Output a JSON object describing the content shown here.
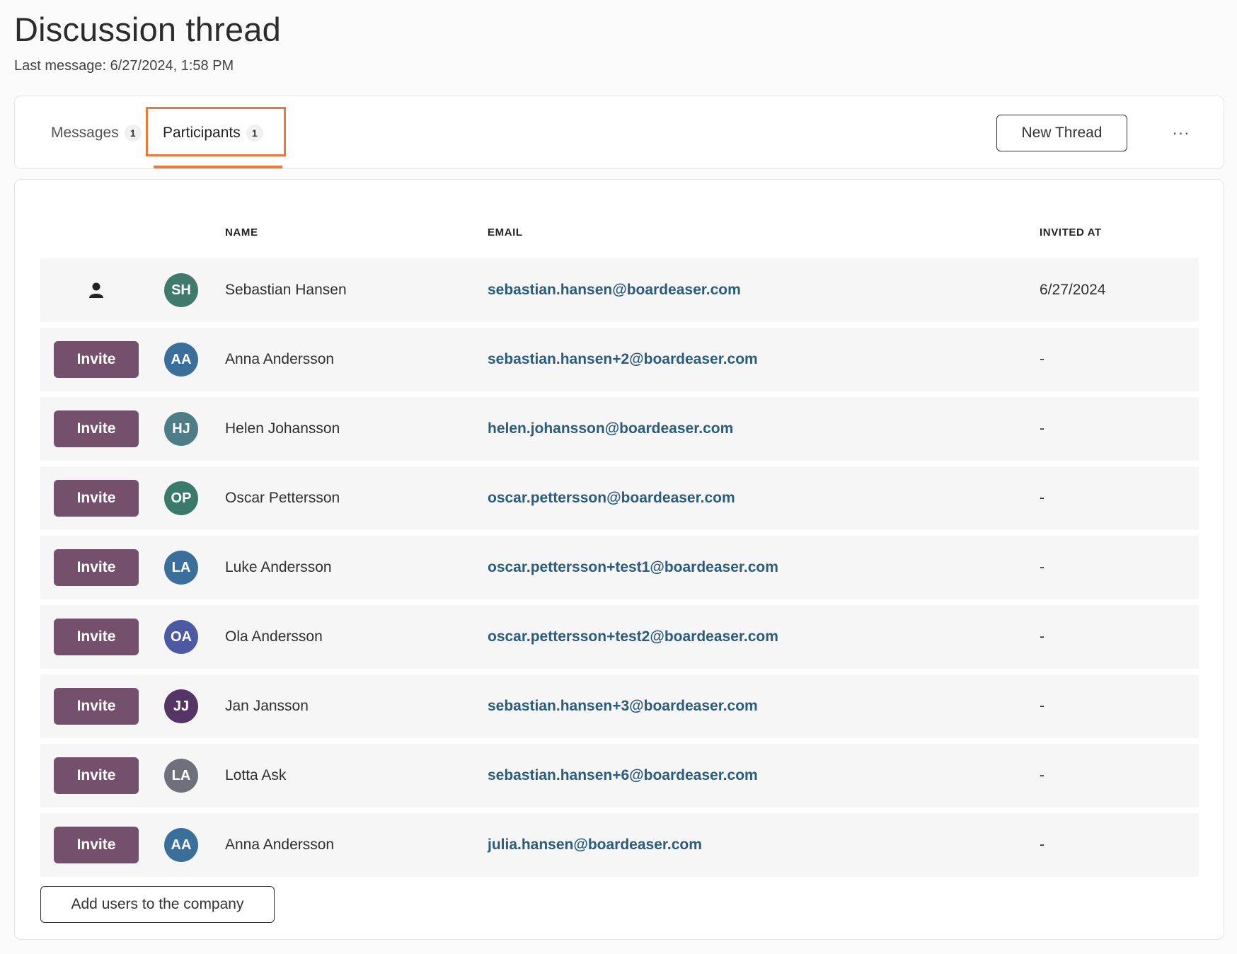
{
  "header": {
    "title": "Discussion thread",
    "last_message": "Last message: 6/27/2024, 1:58 PM"
  },
  "tabs": [
    {
      "label": "Messages",
      "badge": "1"
    },
    {
      "label": "Participants",
      "badge": "1",
      "active": true
    }
  ],
  "toolbar": {
    "new_thread_label": "New Thread",
    "more_label": "···"
  },
  "table": {
    "columns": {
      "name": "NAME",
      "email": "EMAIL",
      "invited_at": "INVITED AT"
    },
    "invite_label": "Invite",
    "rows": [
      {
        "initials": "SH",
        "name": "Sebastian Hansen",
        "email": "sebastian.hansen@boardeaser.com",
        "invited_at": "6/27/2024",
        "avatar_color": "#3f7a6c",
        "action": "user-icon"
      },
      {
        "initials": "AA",
        "name": "Anna Andersson",
        "email": "sebastian.hansen+2@boardeaser.com",
        "invited_at": "-",
        "avatar_color": "#3a6f9c",
        "action": "invite"
      },
      {
        "initials": "HJ",
        "name": "Helen Johansson",
        "email": "helen.johansson@boardeaser.com",
        "invited_at": "-",
        "avatar_color": "#4d7e87",
        "action": "invite"
      },
      {
        "initials": "OP",
        "name": "Oscar Pettersson",
        "email": "oscar.pettersson@boardeaser.com",
        "invited_at": "-",
        "avatar_color": "#3a7a6a",
        "action": "invite"
      },
      {
        "initials": "LA",
        "name": "Luke Andersson",
        "email": "oscar.pettersson+test1@boardeaser.com",
        "invited_at": "-",
        "avatar_color": "#3a6f9c",
        "action": "invite"
      },
      {
        "initials": "OA",
        "name": "Ola Andersson",
        "email": "oscar.pettersson+test2@boardeaser.com",
        "invited_at": "-",
        "avatar_color": "#4d59a3",
        "action": "invite"
      },
      {
        "initials": "JJ",
        "name": "Jan Jansson",
        "email": "sebastian.hansen+3@boardeaser.com",
        "invited_at": "-",
        "avatar_color": "#553565",
        "action": "invite"
      },
      {
        "initials": "LA",
        "name": "Lotta Ask",
        "email": "sebastian.hansen+6@boardeaser.com",
        "invited_at": "-",
        "avatar_color": "#70707b",
        "action": "invite"
      },
      {
        "initials": "AA",
        "name": "Anna Andersson",
        "email": "julia.hansen@boardeaser.com",
        "invited_at": "-",
        "avatar_color": "#3a6f9c",
        "action": "invite"
      }
    ]
  },
  "footer": {
    "add_users_label": "Add users to the company"
  },
  "colors": {
    "accent": "#e87a3a",
    "invite_button": "#74506d",
    "email_link": "#2a5c7e"
  }
}
